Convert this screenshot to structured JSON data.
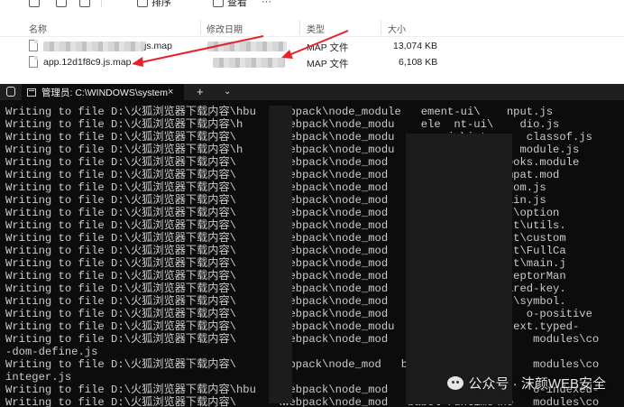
{
  "explorer": {
    "toolbar": {
      "sort_label": "排序",
      "view_label": "查看",
      "more_label": "···"
    },
    "columns": {
      "name": "名称",
      "modified": "修改日期",
      "type": "类型",
      "size": "大小"
    },
    "files": [
      {
        "name": "js.map",
        "type": "MAP 文件",
        "size": "13,074 KB"
      },
      {
        "name": "app.12d1f8c9.js.map",
        "type": "MAP 文件",
        "size": "6,108 KB"
      }
    ],
    "accent_color": "#e8212a"
  },
  "terminal": {
    "tab_title": "管理员: C:\\WINDOWS\\system",
    "close_glyph": "×",
    "new_tab_glyph": "+",
    "dropdown_glyph": "⌄",
    "lines": [
      "Writing to file D:\\火狐浏览器下载内容\\hbu  \\webpack\\node_module   ement-ui\\    nput.js",
      "Writing to file D:\\火狐浏览器下载内容\\h     \\webpack\\node_modu    ele  nt-ui\\    dio.js",
      "Writing to file D:\\火狐浏览器下载内容\\      \\webpack\\node_modu     re-js\\inter    classof.js",
      "Writing to file D:\\火狐浏览器下载内容\\h     \\webpack\\node_modu     t\\dist\\pre    module.js",
      "Writing to file D:\\火狐浏览器下载内容\\      \\webpack\\node_mod      hooks\\di    ooks.module",
      "Writing to file D:\\火狐浏览器下载内容\\      \\webpack\\node_mod      compat    compat.mod",
      "Writing to file D:\\火狐浏览器下载内容\\      \\webpack\\node_mod      alendar    vdom.js",
      "Writing to file D:\\火狐浏览器下载内容\\      \\webpack\\node_mod      alendar    main.js",
      "Writing to file D:\\火狐浏览器下载内容\\      \\webpack\\node_mod      calend    ist\\option",
      "Writing to file D:\\火狐浏览器下载内容\\      \\webpack\\node_mod      calendar   ist\\utils.",
      "Writing to file D:\\火狐浏览器下载内容\\      \\webpack\\node_mod      calendar   ist\\custom",
      "Writing to file D:\\火狐浏览器下载内容\\      \\webpack\\node_mod      calendar   ist\\FullCa",
      "Writing to file D:\\火狐浏览器下载内容\\      \\webpack\\node_mod      calendar   ist\\main.j",
      "Writing to file D:\\火狐浏览器下载内容\\      \\webpack\\node_mod      o\\core\\    rceptorMan",
      "Writing to file D:\\火狐浏览器下载内容\\      \\webpack\\node_mod      interna    hared-key.",
      "Writing to file D:\\火狐浏览器下载内容\\      \\webpack\\node_mod      untime\\    js\\symbol.",
      "Writing to file D:\\火狐浏览器下载内容\\      \\webpack\\node_mod      e-js\\interna   o-positive",
      "Writing to file D:\\火狐浏览器下载内容\\     1\\webpack\\node_modu     js\\modules   ext.typed-",
      "Writing to file D:\\火狐浏览器下载内容\\     1\\webpack\\node_mod   abel-runtime\\no    modules\\co",
      "-dom-define.js",
      "Writing to file D:\\火狐浏览器下载内容\\     \\webpack\\node_mod   babel-runtime\\no    modules\\co",
      "integer.js",
      "Writing to file D:\\火狐浏览器下载内容\\hbu  1\\webpack\\node_mod   core-js\\interna    o-indexed-",
      "Writing to file D:\\火狐浏览器下载内容\\      \\webpack\\node_mod   babel-runtime\\no   modules\\co"
    ]
  },
  "watermark": {
    "text": "公众号 · 沫颜WEB安全"
  }
}
